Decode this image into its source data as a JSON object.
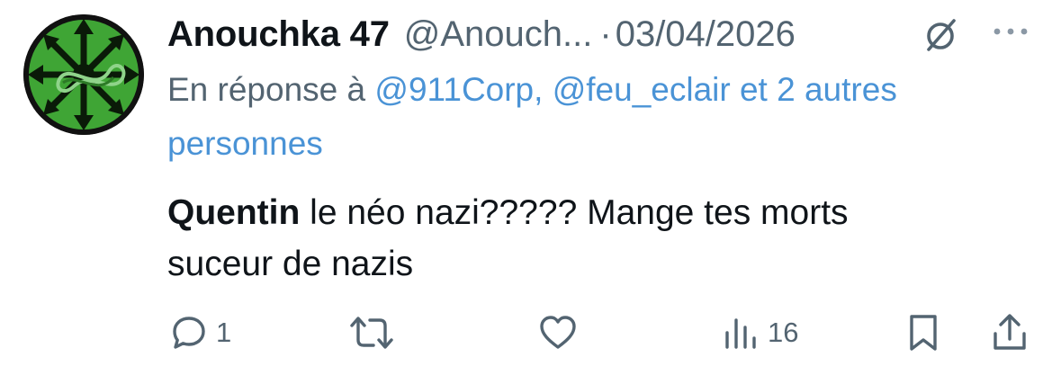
{
  "tweet": {
    "display_name": "Anouchka 47",
    "handle": "@Anouch...",
    "separator": "·",
    "date": "03/04/2026",
    "reply": {
      "prefix": "En réponse à",
      "mention_1": "@911Corp,",
      "mention_2": "@feu_eclair",
      "suffix": "et 2 autres personnes"
    },
    "body": {
      "bold": "Quentin",
      "line_1_rest": " le néo nazi????? Mange tes morts",
      "line_2": "suceur de nazis"
    }
  },
  "actions": {
    "reply": {
      "icon": "reply-icon",
      "count": "1"
    },
    "retweet": {
      "icon": "retweet-icon"
    },
    "like": {
      "icon": "heart-icon"
    },
    "views": {
      "icon": "views-icon",
      "count": "16"
    },
    "bookmark": {
      "icon": "bookmark-icon"
    },
    "share": {
      "icon": "share-icon"
    }
  },
  "header_icons": {
    "grok": "grok-icon",
    "more": "more-icon"
  },
  "colors": {
    "text": "#0f1419",
    "secondary": "#536471",
    "link": "#4a93d6",
    "avatar_green": "#3fa535",
    "avatar_bg": "#111111"
  }
}
